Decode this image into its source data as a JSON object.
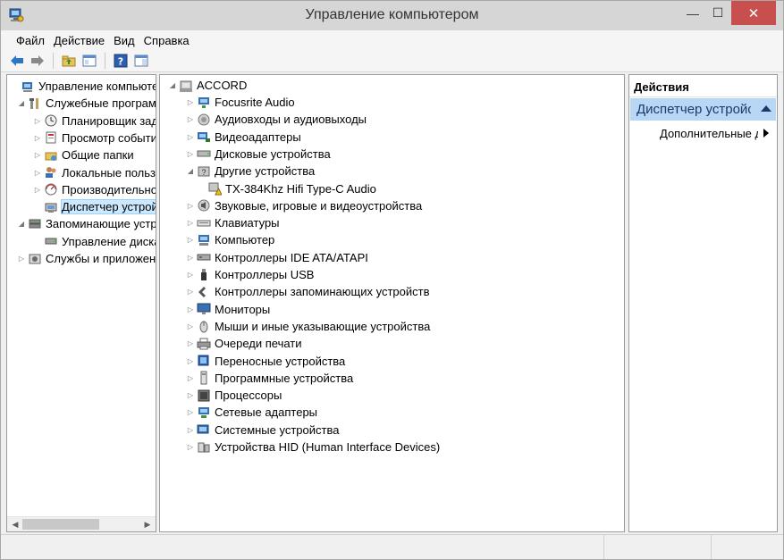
{
  "window": {
    "title": "Управление компьютером",
    "min_glyph": "—",
    "max_glyph": "☐",
    "close_glyph": "✕"
  },
  "menu": {
    "file": "Файл",
    "action": "Действие",
    "view": "Вид",
    "help": "Справка"
  },
  "left_tree": [
    {
      "label": "Управление компьютером (локальным)",
      "icon": "computer-management-icon",
      "level": 0,
      "expander": "",
      "selected": false
    },
    {
      "label": "Служебные программы",
      "icon": "tools-icon",
      "level": 1,
      "expander": "open",
      "selected": false
    },
    {
      "label": "Планировщик заданий",
      "icon": "clock-icon",
      "level": 2,
      "expander": "closed",
      "selected": false
    },
    {
      "label": "Просмотр событий",
      "icon": "event-viewer-icon",
      "level": 2,
      "expander": "closed",
      "selected": false
    },
    {
      "label": "Общие папки",
      "icon": "shared-folder-icon",
      "level": 2,
      "expander": "closed",
      "selected": false
    },
    {
      "label": "Локальные пользователи",
      "icon": "users-icon",
      "level": 2,
      "expander": "closed",
      "selected": false
    },
    {
      "label": "Производительность",
      "icon": "performance-icon",
      "level": 2,
      "expander": "closed",
      "selected": false
    },
    {
      "label": "Диспетчер устройств",
      "icon": "device-manager-icon",
      "level": 2,
      "expander": "",
      "selected": true
    },
    {
      "label": "Запоминающие устройства",
      "icon": "storage-icon",
      "level": 1,
      "expander": "open",
      "selected": false
    },
    {
      "label": "Управление дисками",
      "icon": "disk-management-icon",
      "level": 2,
      "expander": "",
      "selected": false
    },
    {
      "label": "Службы и приложения",
      "icon": "services-icon",
      "level": 1,
      "expander": "closed",
      "selected": false
    }
  ],
  "device_tree": {
    "root": "ACCORD",
    "items": [
      {
        "label": "Focusrite Audio",
        "icon": "audio-network-icon",
        "expander": "closed",
        "level": 1
      },
      {
        "label": "Аудиовходы и аудиовыходы",
        "icon": "speaker-icon",
        "expander": "closed",
        "level": 1
      },
      {
        "label": "Видеоадаптеры",
        "icon": "display-adapter-icon",
        "expander": "closed",
        "level": 1
      },
      {
        "label": "Дисковые устройства",
        "icon": "disk-drive-icon",
        "expander": "closed",
        "level": 1
      },
      {
        "label": "Другие устройства",
        "icon": "unknown-device-icon",
        "expander": "open",
        "level": 1
      },
      {
        "label": "TX-384Khz Hifi Type-C Audio",
        "icon": "warning-device-icon",
        "expander": "",
        "level": 2
      },
      {
        "label": "Звуковые, игровые и видеоустройства",
        "icon": "sound-icon",
        "expander": "closed",
        "level": 1
      },
      {
        "label": "Клавиатуры",
        "icon": "keyboard-icon",
        "expander": "closed",
        "level": 1
      },
      {
        "label": "Компьютер",
        "icon": "computer-icon",
        "expander": "closed",
        "level": 1
      },
      {
        "label": "Контроллеры IDE ATA/ATAPI",
        "icon": "ide-controller-icon",
        "expander": "closed",
        "level": 1
      },
      {
        "label": "Контроллеры USB",
        "icon": "usb-icon",
        "expander": "closed",
        "level": 1
      },
      {
        "label": "Контроллеры запоминающих устройств",
        "icon": "storage-controller-icon",
        "expander": "closed",
        "level": 1
      },
      {
        "label": "Мониторы",
        "icon": "monitor-icon",
        "expander": "closed",
        "level": 1
      },
      {
        "label": "Мыши и иные указывающие устройства",
        "icon": "mouse-icon",
        "expander": "closed",
        "level": 1
      },
      {
        "label": "Очереди печати",
        "icon": "printer-icon",
        "expander": "closed",
        "level": 1
      },
      {
        "label": "Переносные устройства",
        "icon": "portable-device-icon",
        "expander": "closed",
        "level": 1
      },
      {
        "label": "Программные устройства",
        "icon": "software-device-icon",
        "expander": "closed",
        "level": 1
      },
      {
        "label": "Процессоры",
        "icon": "processor-icon",
        "expander": "closed",
        "level": 1
      },
      {
        "label": "Сетевые адаптеры",
        "icon": "network-adapter-icon",
        "expander": "closed",
        "level": 1
      },
      {
        "label": "Системные устройства",
        "icon": "system-device-icon",
        "expander": "closed",
        "level": 1
      },
      {
        "label": "Устройства HID (Human Interface Devices)",
        "icon": "hid-icon",
        "expander": "closed",
        "level": 1
      }
    ]
  },
  "actions": {
    "header": "Действия",
    "section": "Диспетчер устройств",
    "more": "Дополнительные действия"
  },
  "colors": {
    "title_bar": "#d6d6d6",
    "close_button": "#c7504f",
    "selection": "#cce8ff",
    "actions_section": "#b8d6f5"
  }
}
